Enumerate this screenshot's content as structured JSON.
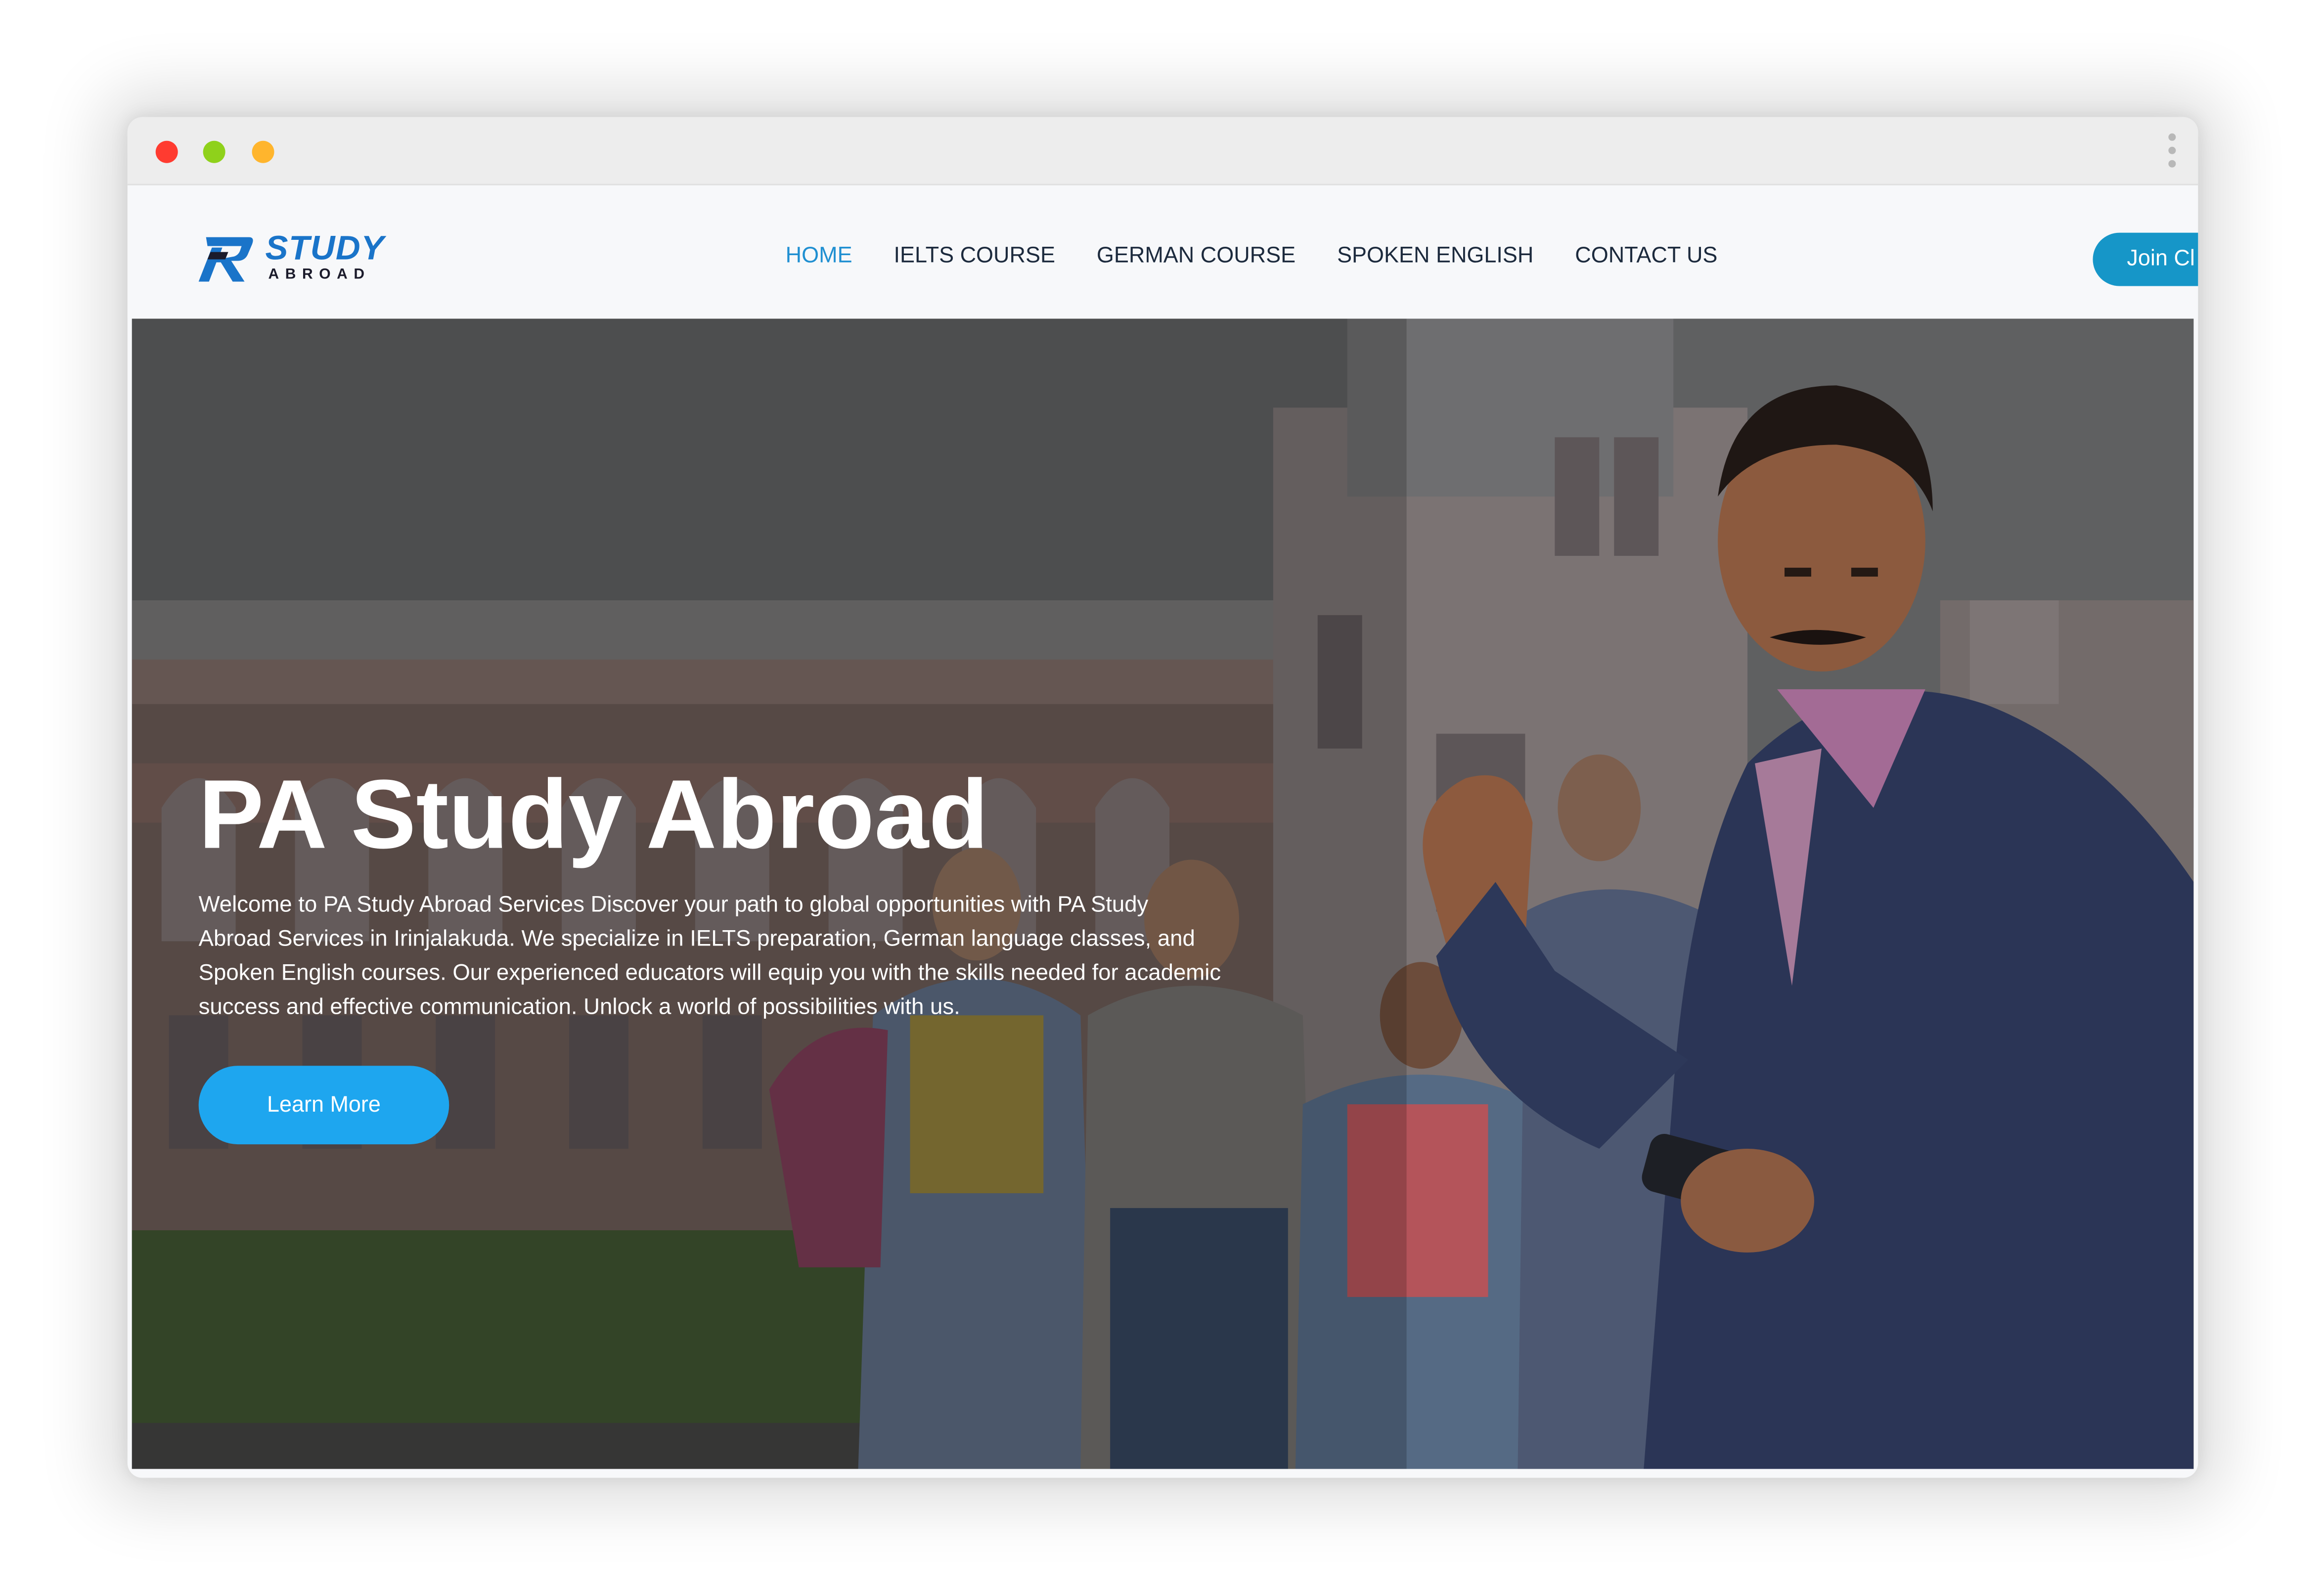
{
  "window": {
    "controls": [
      "close",
      "minimize",
      "maximize"
    ],
    "menu_icon": "more-vertical-icon"
  },
  "header": {
    "logo": {
      "primary": "STUDY",
      "secondary": "ABROAD"
    },
    "nav": [
      {
        "label": "HOME",
        "active": true
      },
      {
        "label": "IELTS COURSE",
        "active": false
      },
      {
        "label": "GERMAN COURSE",
        "active": false
      },
      {
        "label": "SPOKEN ENGLISH",
        "active": false
      },
      {
        "label": "CONTACT US",
        "active": false
      }
    ],
    "join_label": "Join Cl"
  },
  "hero": {
    "title": "PA Study Abroad",
    "description": "Welcome to PA Study Abroad Services Discover your path to global opportunities with PA Study Abroad Services in Irinjalakuda. We specialize in IELTS preparation, German language classes, and Spoken English courses. Our experienced educators will equip you with the skills needed for academic success and effective communication. Unlock a world of possibilities with us.",
    "button_label": "Learn More"
  },
  "colors": {
    "accent": "#1f8fd1",
    "join_button": "#1696c8",
    "learn_button": "#1ea6ef",
    "nav_text": "#1c2a3d",
    "close": "#ff3b30",
    "minimize": "#8fd11b",
    "maximize": "#ffb52d"
  }
}
